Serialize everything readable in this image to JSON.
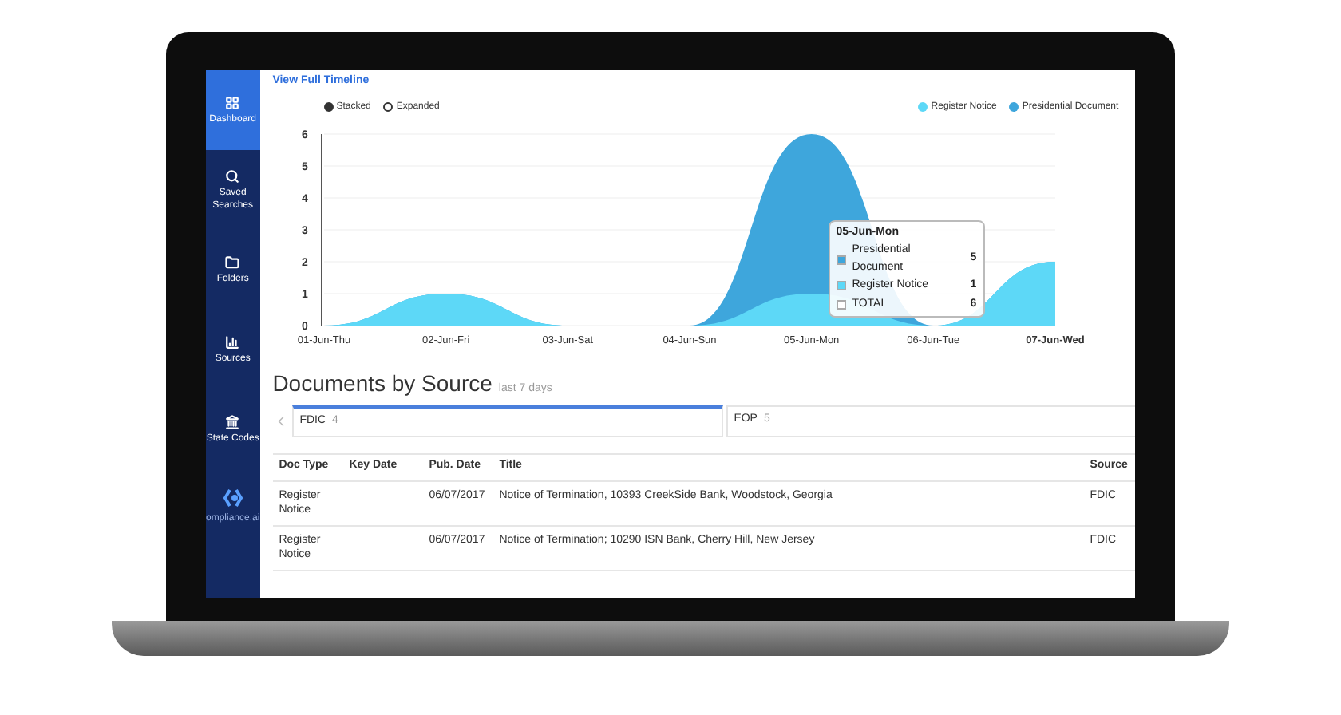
{
  "sidebar": {
    "items": [
      {
        "label": "Dashboard",
        "selected": true
      },
      {
        "label": "Saved Searches",
        "selected": false
      },
      {
        "label": "Folders",
        "selected": false
      },
      {
        "label": "Sources",
        "selected": false
      },
      {
        "label": "State Codes",
        "selected": false
      }
    ],
    "logo": "ompliance.ai"
  },
  "timeline_link": "View Full Timeline",
  "view_options": [
    {
      "label": "Stacked",
      "selected": true
    },
    {
      "label": "Expanded",
      "selected": false
    }
  ],
  "chart": {
    "chart_data": {
      "type": "area",
      "stacked": true,
      "categories": [
        "01-Jun-Thu",
        "02-Jun-Fri",
        "03-Jun-Sat",
        "04-Jun-Sun",
        "05-Jun-Mon",
        "06-Jun-Tue",
        "07-Jun-Wed"
      ],
      "series": [
        {
          "name": "Register Notice",
          "color": "#5dd8f7",
          "values": [
            0,
            1,
            0,
            0,
            1,
            0,
            2
          ]
        },
        {
          "name": "Presidential Document",
          "color": "#3ea6dc",
          "values": [
            0,
            0,
            0,
            0,
            5,
            0,
            0
          ]
        }
      ],
      "ylim": [
        0,
        6
      ],
      "yticks": [
        0,
        1,
        2,
        3,
        4,
        5,
        6
      ],
      "grid": true,
      "legend": "top-right"
    },
    "tooltip": {
      "title": "05-Jun-Mon",
      "rows": [
        {
          "label": "Presidential Document",
          "value": "5",
          "color": "#3ea6dc"
        },
        {
          "label": "Register Notice",
          "value": "1",
          "color": "#5dd8f7"
        },
        {
          "label": "TOTAL",
          "value": "6"
        }
      ]
    }
  },
  "section": {
    "title": "Documents by Source",
    "subtitle": "last 7 days"
  },
  "source_tabs": [
    {
      "label": "FDIC",
      "count": "4",
      "selected": true
    },
    {
      "label": "EOP",
      "count": "5",
      "selected": false
    }
  ],
  "table": {
    "columns": [
      "Doc Type",
      "Key Date",
      "Pub. Date",
      "Title",
      "Source"
    ],
    "rows": [
      {
        "doc_type": "Register Notice",
        "pub_date": "06/07/2017",
        "title": "Notice of Termination, 10393 CreekSide Bank, Woodstock, Georgia",
        "source": "FDIC"
      },
      {
        "doc_type": "Register Notice",
        "pub_date": "06/07/2017",
        "title": "Notice of Termination; 10290 ISN Bank, Cherry Hill, New Jersey",
        "source": "FDIC"
      }
    ]
  }
}
